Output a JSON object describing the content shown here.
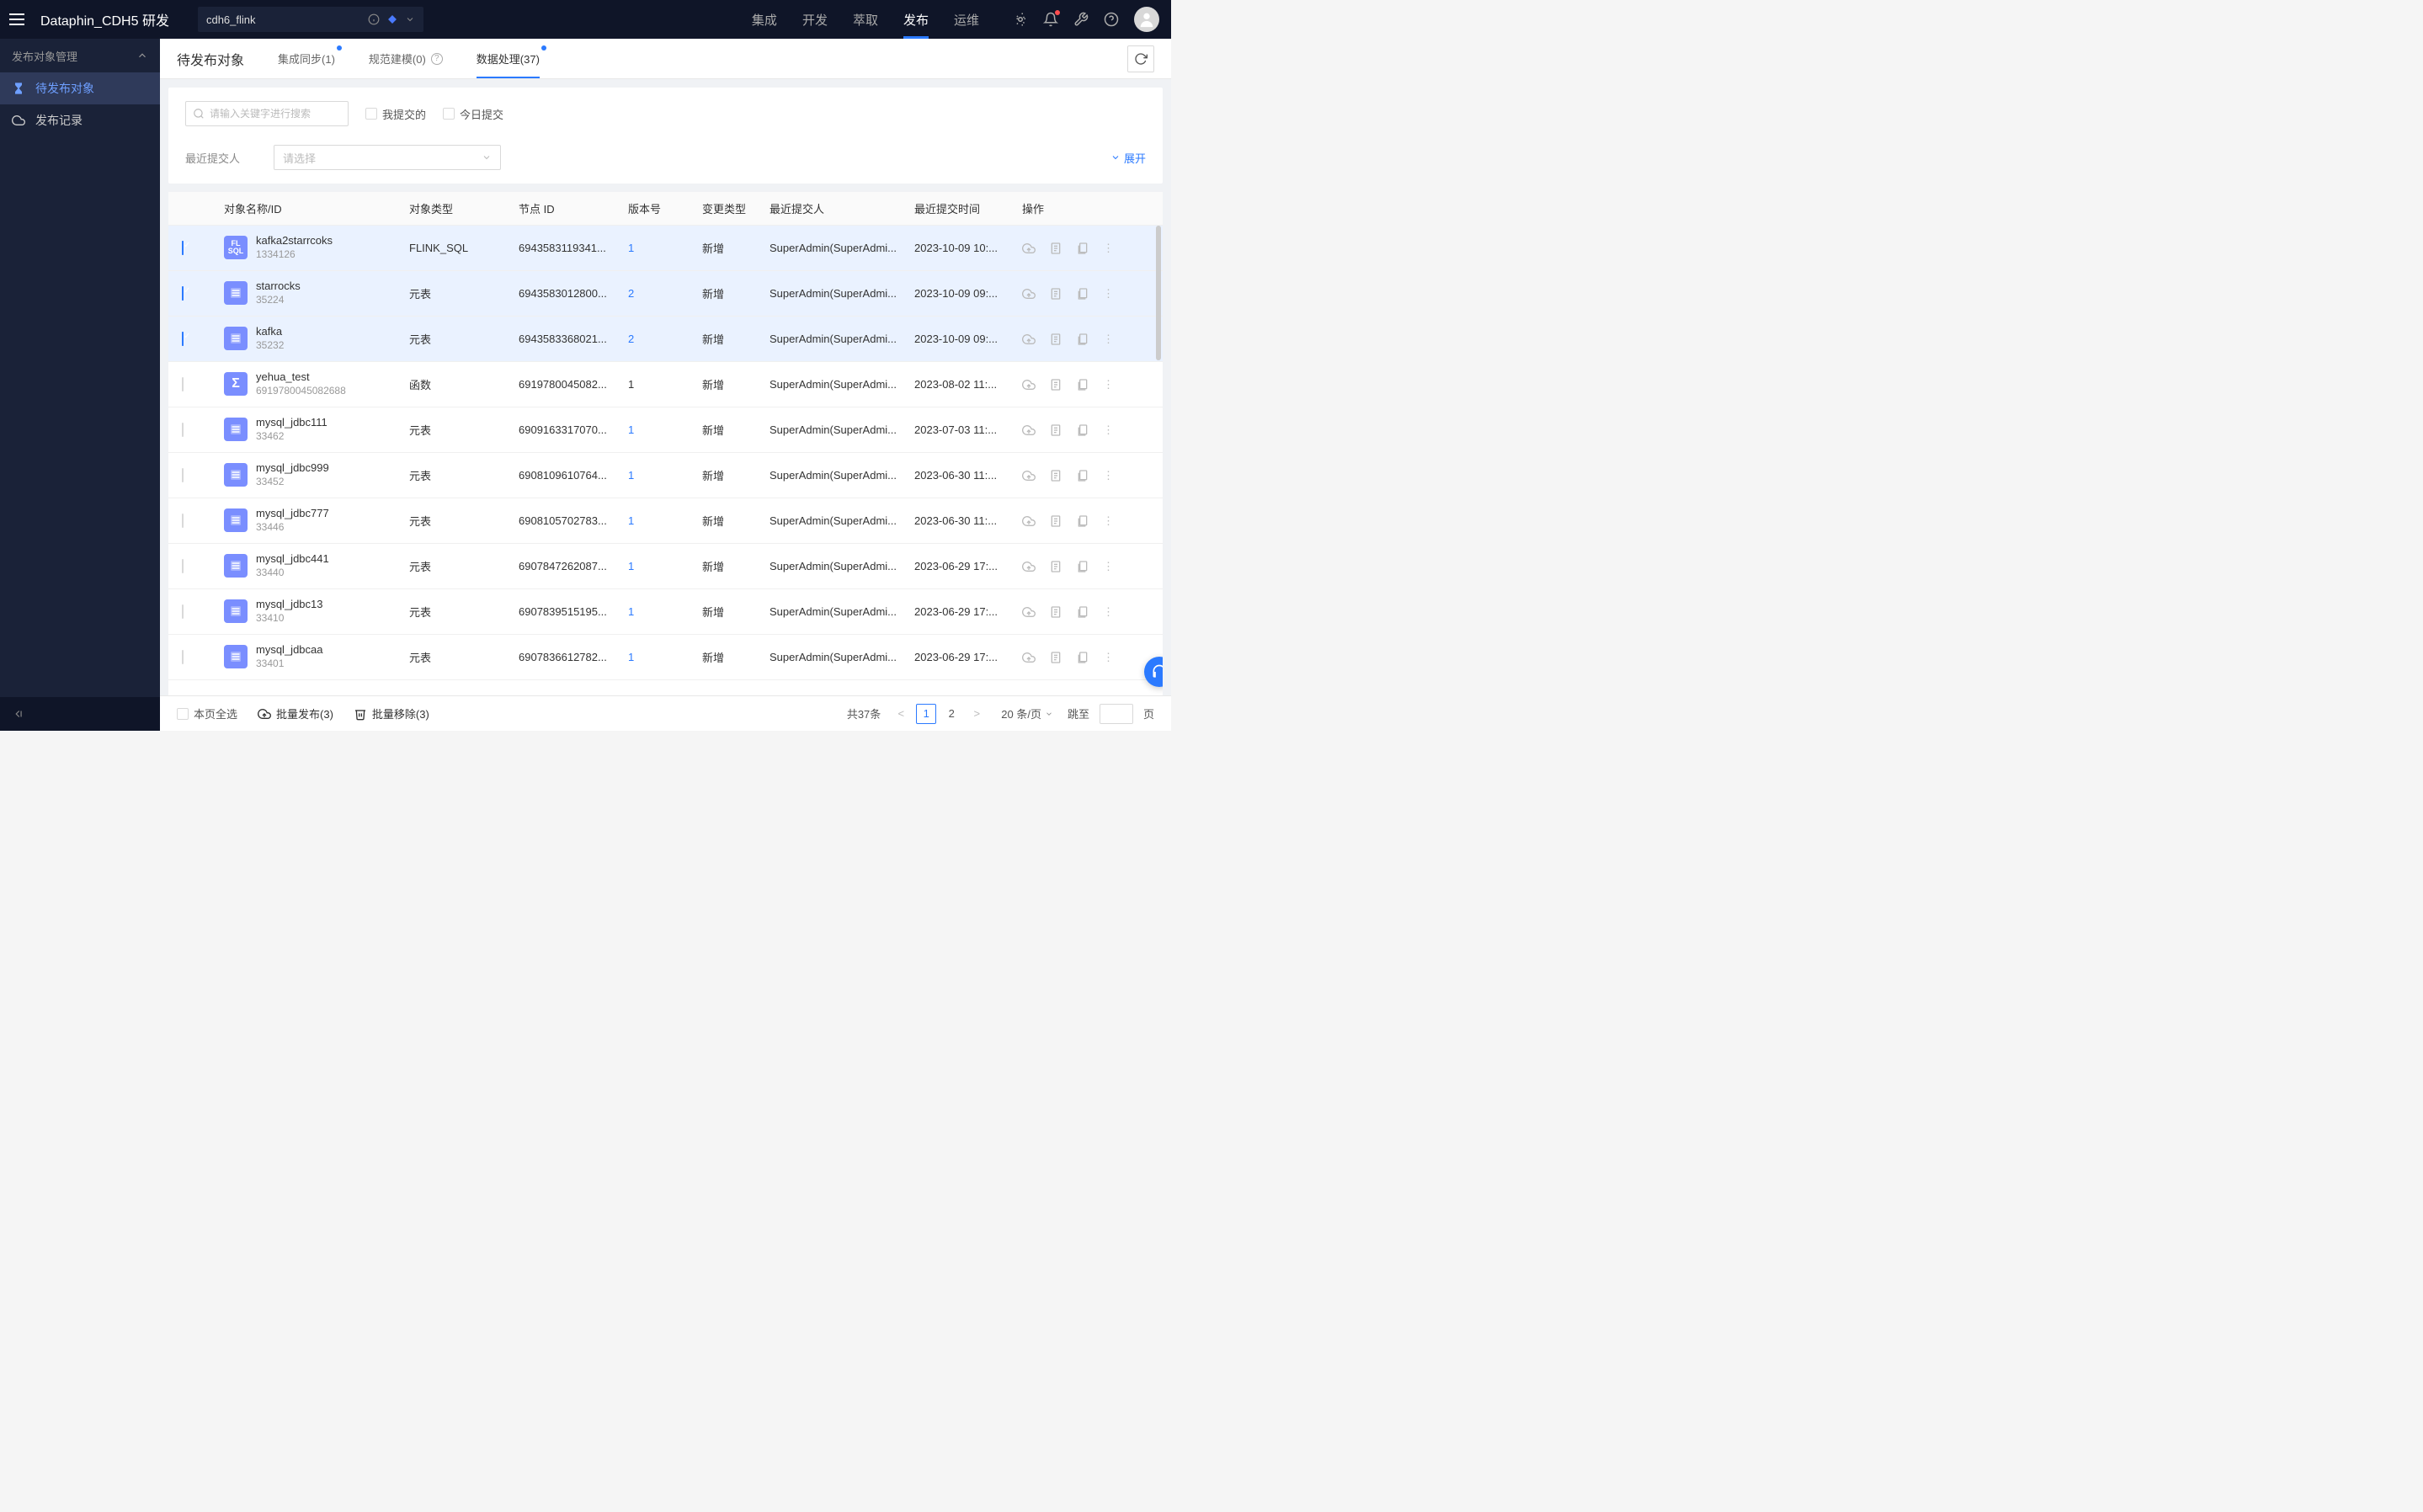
{
  "app_title": "Dataphin_CDH5 研发",
  "project_name": "cdh6_flink",
  "topnav": [
    "集成",
    "开发",
    "萃取",
    "发布",
    "运维"
  ],
  "topnav_active": 3,
  "sidebar": {
    "header": "发布对象管理",
    "items": [
      {
        "label": "待发布对象",
        "active": true
      },
      {
        "label": "发布记录",
        "active": false
      }
    ]
  },
  "page_title": "待发布对象",
  "tabs": [
    {
      "label": "集成同步(1)",
      "dot": true,
      "help": false
    },
    {
      "label": "规范建模(0)",
      "dot": false,
      "help": true
    },
    {
      "label": "数据处理(37)",
      "dot": true,
      "help": false,
      "active": true
    }
  ],
  "filters": {
    "search_placeholder": "请输入关键字进行搜索",
    "chk_mine": "我提交的",
    "chk_today": "今日提交",
    "submitter_label": "最近提交人",
    "select_placeholder": "请选择",
    "expand": "展开"
  },
  "columns": {
    "name": "对象名称/ID",
    "type": "对象类型",
    "node": "节点 ID",
    "ver": "版本号",
    "change": "变更类型",
    "user": "最近提交人",
    "time": "最近提交时间",
    "ops": "操作"
  },
  "rows": [
    {
      "checked": true,
      "icon": "sql",
      "name": "kafka2starrcoks",
      "id": "1334126",
      "type": "FLINK_SQL",
      "node": "6943583119341...",
      "ver": "1",
      "ver_link": true,
      "change": "新增",
      "user": "SuperAdmin(SuperAdmi...",
      "time": "2023-10-09 10:..."
    },
    {
      "checked": true,
      "icon": "table",
      "name": "starrocks",
      "id": "35224",
      "type": "元表",
      "node": "6943583012800...",
      "ver": "2",
      "ver_link": true,
      "change": "新增",
      "user": "SuperAdmin(SuperAdmi...",
      "time": "2023-10-09 09:..."
    },
    {
      "checked": true,
      "icon": "table",
      "name": "kafka",
      "id": "35232",
      "type": "元表",
      "node": "6943583368021...",
      "ver": "2",
      "ver_link": true,
      "change": "新增",
      "user": "SuperAdmin(SuperAdmi...",
      "time": "2023-10-09 09:..."
    },
    {
      "checked": false,
      "icon": "fn",
      "name": "yehua_test",
      "id": "6919780045082688",
      "type": "函数",
      "node": "6919780045082...",
      "ver": "1",
      "ver_link": false,
      "change": "新增",
      "user": "SuperAdmin(SuperAdmi...",
      "time": "2023-08-02 11:..."
    },
    {
      "checked": false,
      "icon": "table",
      "name": "mysql_jdbc111",
      "id": "33462",
      "type": "元表",
      "node": "6909163317070...",
      "ver": "1",
      "ver_link": true,
      "change": "新增",
      "user": "SuperAdmin(SuperAdmi...",
      "time": "2023-07-03 11:..."
    },
    {
      "checked": false,
      "icon": "table",
      "name": "mysql_jdbc999",
      "id": "33452",
      "type": "元表",
      "node": "6908109610764...",
      "ver": "1",
      "ver_link": true,
      "change": "新增",
      "user": "SuperAdmin(SuperAdmi...",
      "time": "2023-06-30 11:..."
    },
    {
      "checked": false,
      "icon": "table",
      "name": "mysql_jdbc777",
      "id": "33446",
      "type": "元表",
      "node": "6908105702783...",
      "ver": "1",
      "ver_link": true,
      "change": "新增",
      "user": "SuperAdmin(SuperAdmi...",
      "time": "2023-06-30 11:..."
    },
    {
      "checked": false,
      "icon": "table",
      "name": "mysql_jdbc441",
      "id": "33440",
      "type": "元表",
      "node": "6907847262087...",
      "ver": "1",
      "ver_link": true,
      "change": "新增",
      "user": "SuperAdmin(SuperAdmi...",
      "time": "2023-06-29 17:..."
    },
    {
      "checked": false,
      "icon": "table",
      "name": "mysql_jdbc13",
      "id": "33410",
      "type": "元表",
      "node": "6907839515195...",
      "ver": "1",
      "ver_link": true,
      "change": "新增",
      "user": "SuperAdmin(SuperAdmi...",
      "time": "2023-06-29 17:..."
    },
    {
      "checked": false,
      "icon": "table",
      "name": "mysql_jdbcaa",
      "id": "33401",
      "type": "元表",
      "node": "6907836612782...",
      "ver": "1",
      "ver_link": true,
      "change": "新增",
      "user": "SuperAdmin(SuperAdmi...",
      "time": "2023-06-29 17:..."
    }
  ],
  "footer": {
    "select_all": "本页全选",
    "batch_publish": "批量发布(3)",
    "batch_remove": "批量移除(3)",
    "total": "共37条",
    "page_current": "1",
    "page_other": "2",
    "page_size": "20 条/页",
    "jump_to": "跳至",
    "page_suffix": "页"
  }
}
